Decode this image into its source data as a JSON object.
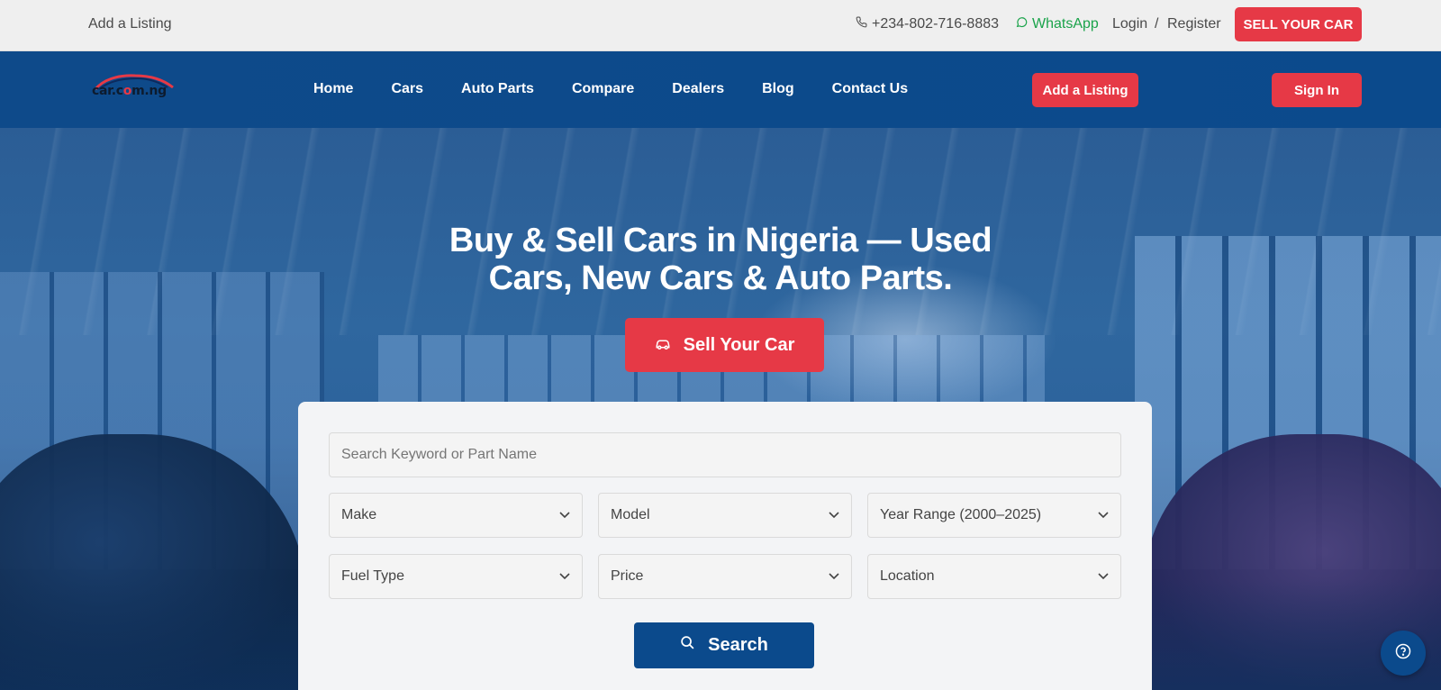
{
  "topbar": {
    "add_listing": "Add a Listing",
    "phone": "+234-802-716-8883",
    "whatsapp": "WhatsApp",
    "login": "Login",
    "separator": "/",
    "register": "Register",
    "sell_button": "SELL YOUR CAR"
  },
  "logo": {
    "text_part1": "car.c",
    "text_part2": "o",
    "text_part3": "m.ng"
  },
  "nav": {
    "items": [
      {
        "label": "Home"
      },
      {
        "label": "Cars"
      },
      {
        "label": "Auto Parts"
      },
      {
        "label": "Compare"
      },
      {
        "label": "Dealers"
      },
      {
        "label": "Blog"
      },
      {
        "label": "Contact Us"
      }
    ],
    "add_listing": "Add a Listing",
    "sign_in": "Sign In"
  },
  "hero": {
    "title_line1": "Buy & Sell Cars in Nigeria — Used",
    "title_line2": "Cars, New Cars & Auto Parts.",
    "sell_button": "Sell Your Car"
  },
  "search": {
    "keyword_placeholder": "Search Keyword or Part Name",
    "make": "Make",
    "model": "Model",
    "year_range": "Year Range (2000–2025)",
    "fuel_type": "Fuel Type",
    "price": "Price",
    "location": "Location",
    "search_button": "Search"
  },
  "colors": {
    "brand_red": "#e63946",
    "brand_blue": "#0b4a8c",
    "whatsapp_green": "#1aa34a"
  },
  "icons": {
    "phone": "phone-icon",
    "whatsapp": "whatsapp-icon",
    "car": "car-icon",
    "search": "search-icon",
    "chevron": "chevron-down-icon",
    "help": "help-icon"
  }
}
